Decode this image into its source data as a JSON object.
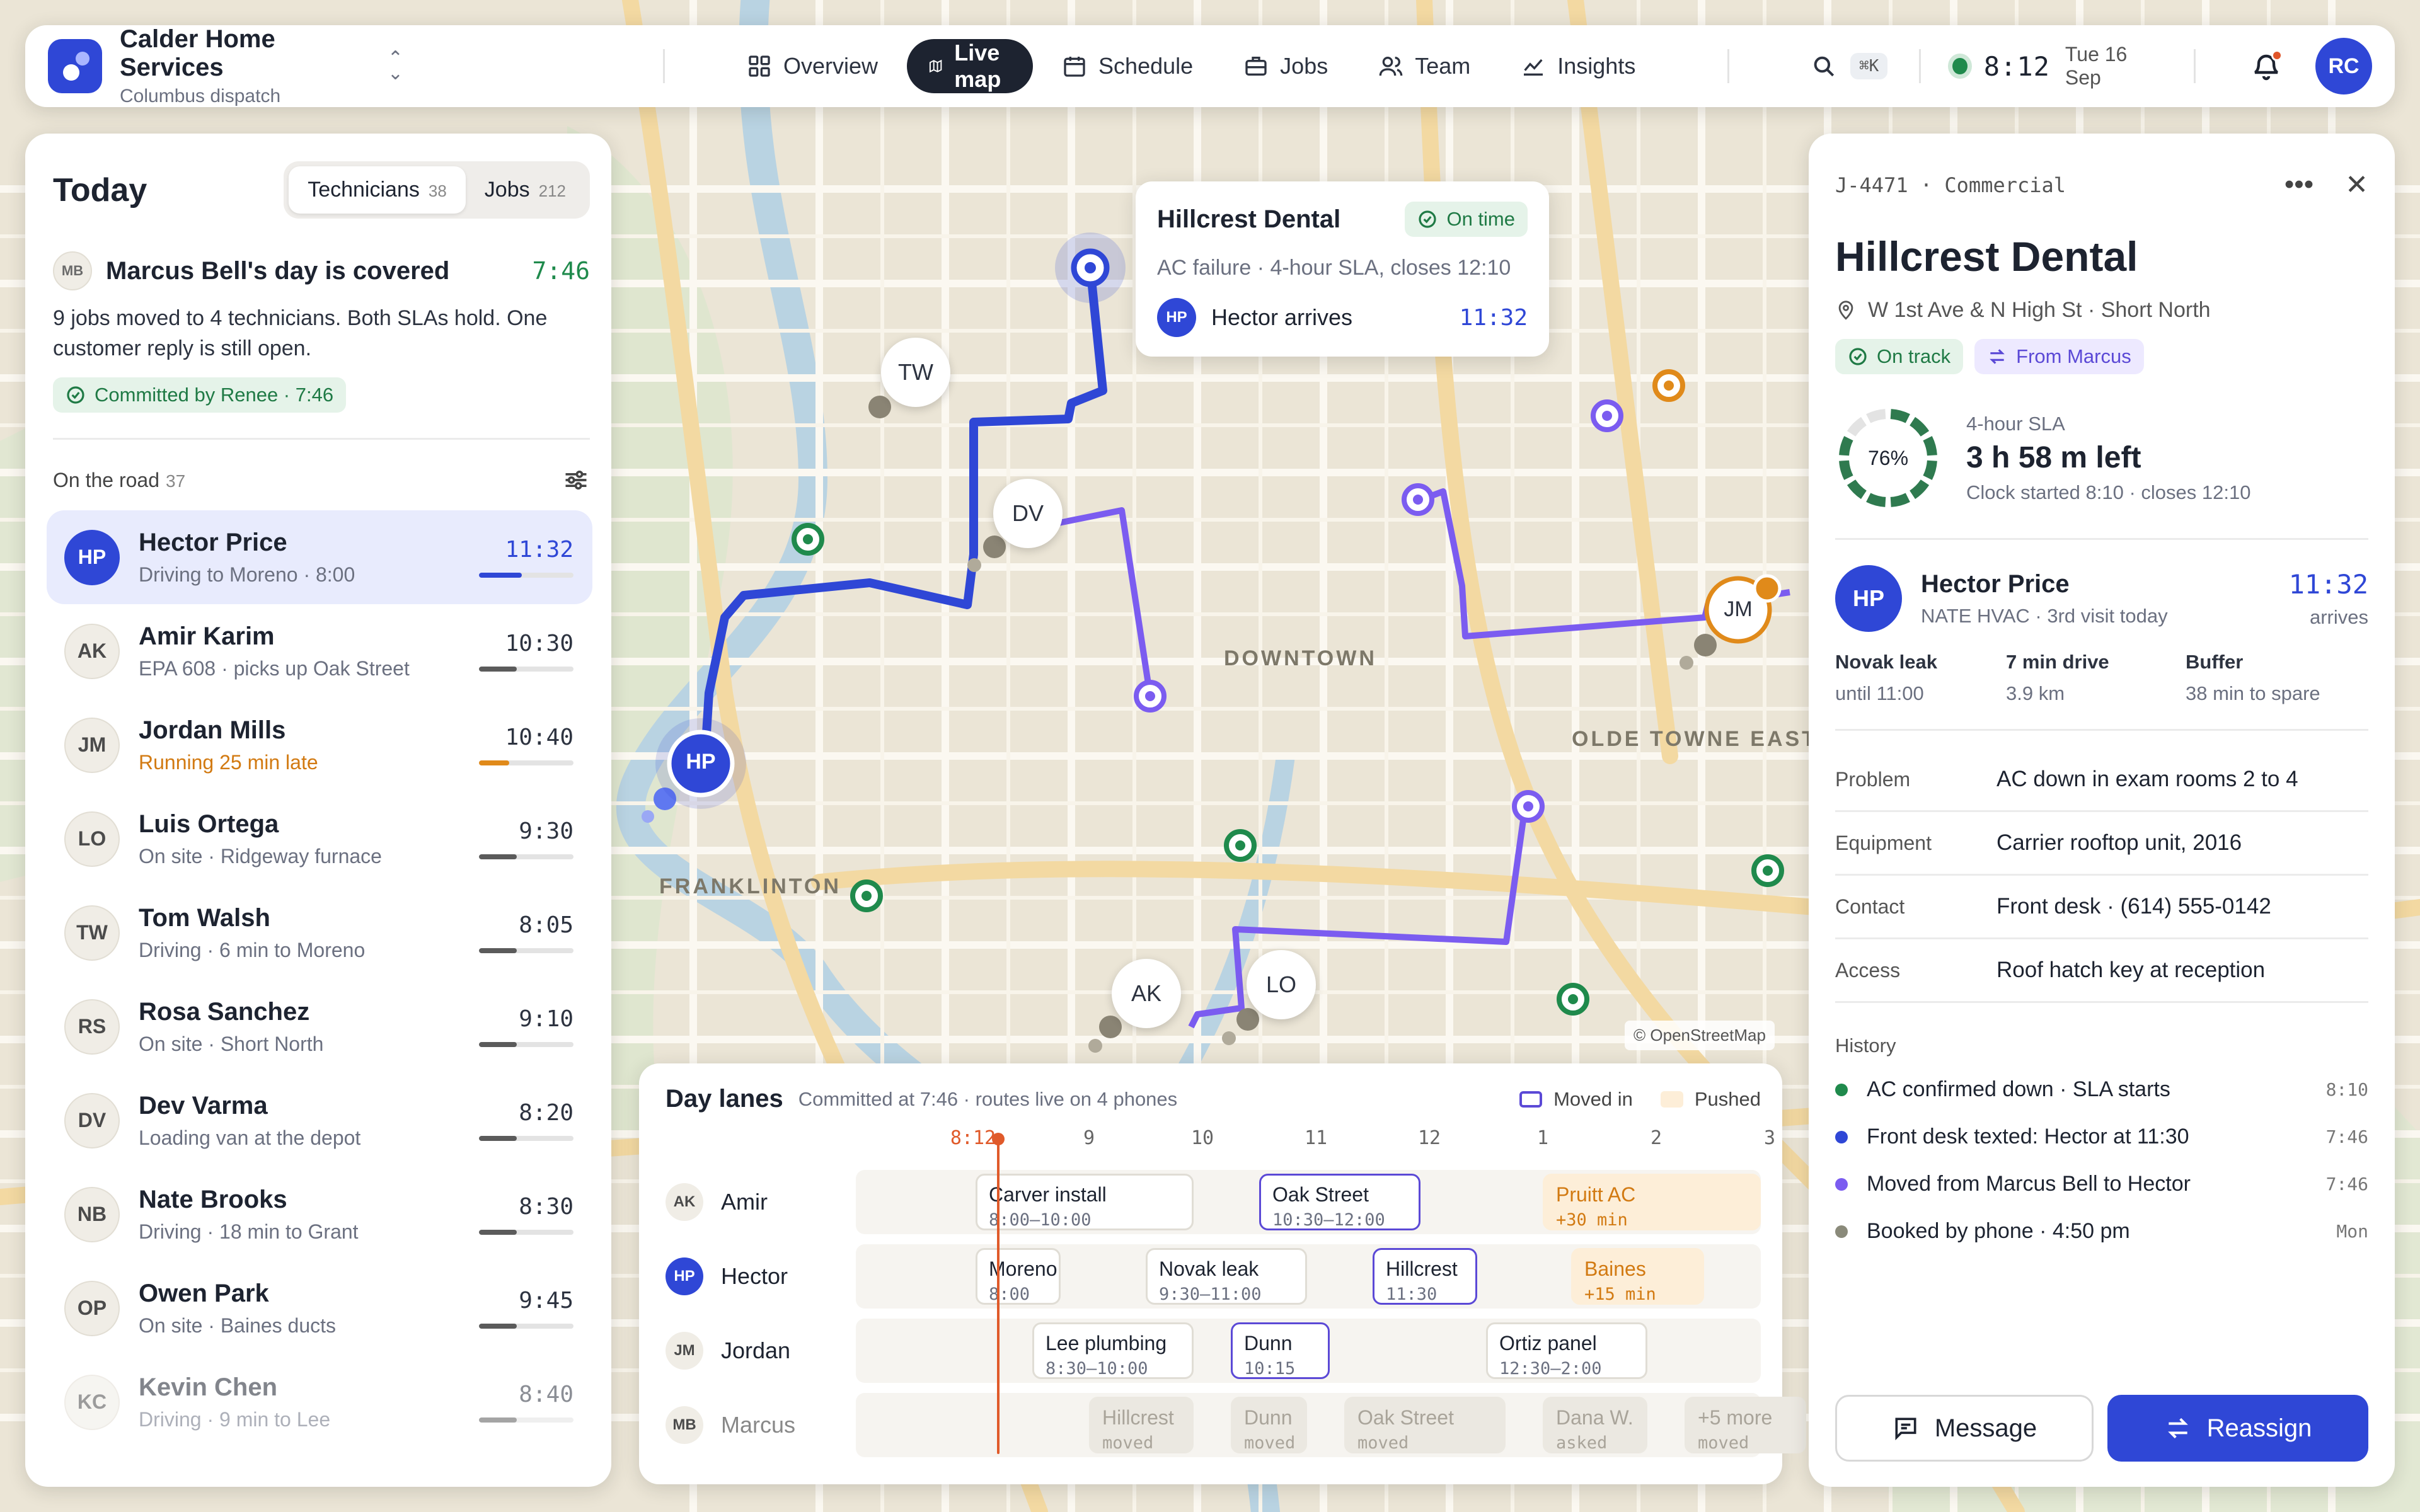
{
  "header": {
    "brand_name": "Calder Home Services",
    "brand_sub": "Columbus dispatch",
    "nav": [
      {
        "label": "Overview",
        "icon": "grid-icon"
      },
      {
        "label": "Live map",
        "icon": "map-icon",
        "active": true
      },
      {
        "label": "Schedule",
        "icon": "calendar-icon"
      },
      {
        "label": "Jobs",
        "icon": "briefcase-icon"
      },
      {
        "label": "Team",
        "icon": "team-icon"
      },
      {
        "label": "Insights",
        "icon": "chart-icon"
      }
    ],
    "shortcut": "⌘K",
    "time": "8:12",
    "date": "Tue 16 Sep",
    "user_initials": "RC"
  },
  "left": {
    "title": "Today",
    "tabs": [
      {
        "label": "Technicians",
        "count": "38"
      },
      {
        "label": "Jobs",
        "count": "212"
      }
    ],
    "cover": {
      "initials": "MB",
      "title": "Marcus Bell's day is covered",
      "time": "7:46",
      "body": "9 jobs moved to 4 technicians. Both SLAs hold. One customer reply is still open.",
      "committed": "Committed by Renee · 7:46"
    },
    "road_label": "On the road",
    "road_count": "37",
    "techs": [
      {
        "initials": "HP",
        "name": "Hector Price",
        "sub": "Driving to Moreno · 8:00",
        "time": "11:32",
        "progress": 0.45,
        "selected": true
      },
      {
        "initials": "AK",
        "name": "Amir Karim",
        "sub": "EPA 608 · picks up Oak Street",
        "time": "10:30",
        "progress": 0.4
      },
      {
        "initials": "JM",
        "name": "Jordan Mills",
        "sub": "Running 25 min late",
        "time": "10:40",
        "progress": 0.32,
        "late": true
      },
      {
        "initials": "LO",
        "name": "Luis Ortega",
        "sub": "On site · Ridgeway furnace",
        "time": "9:30",
        "progress": 0.4
      },
      {
        "initials": "TW",
        "name": "Tom Walsh",
        "sub": "Driving · 6 min to Moreno",
        "time": "8:05",
        "progress": 0.4
      },
      {
        "initials": "RS",
        "name": "Rosa Sanchez",
        "sub": "On site · Short North",
        "time": "9:10",
        "progress": 0.4
      },
      {
        "initials": "DV",
        "name": "Dev Varma",
        "sub": "Loading van at the depot",
        "time": "8:20",
        "progress": 0.4
      },
      {
        "initials": "NB",
        "name": "Nate Brooks",
        "sub": "Driving · 18 min to Grant",
        "time": "8:30",
        "progress": 0.4
      },
      {
        "initials": "OP",
        "name": "Owen Park",
        "sub": "On site · Baines ducts",
        "time": "9:45",
        "progress": 0.4
      },
      {
        "initials": "KC",
        "name": "Kevin Chen",
        "sub": "Driving · 9 min to Lee",
        "time": "8:40",
        "progress": 0.4,
        "dim": true
      }
    ]
  },
  "map": {
    "chips": [
      "TW",
      "DV",
      "AK",
      "LO",
      "HP",
      "JM"
    ],
    "districts": [
      "DOWNTOWN",
      "OLDE TOWNE EAST",
      "FRANKLINTON"
    ],
    "attribution": "© OpenStreetMap",
    "popup": {
      "title": "Hillcrest Dental",
      "status": "On time",
      "sub": "AC failure · 4-hour SLA, closes 12:10",
      "initials": "HP",
      "arrives": "Hector arrives",
      "time": "11:32"
    }
  },
  "lanes": {
    "title": "Day lanes",
    "sub": "Committed at 7:46 · routes live on 4 phones",
    "legend": [
      "Moved in",
      "Pushed"
    ],
    "now_label": "8:12",
    "ticks": [
      "9",
      "10",
      "11",
      "12",
      "1",
      "2",
      "3"
    ],
    "rows": [
      {
        "initials": "AK",
        "name": "Amir",
        "blocks": [
          {
            "title": "Carver install",
            "sub": "8:00–10:00"
          },
          {
            "title": "Oak Street",
            "sub": "10:30–12:00"
          },
          {
            "title": "Pruitt AC",
            "sub": "+30 min"
          }
        ]
      },
      {
        "initials": "HP",
        "name": "Hector",
        "blocks": [
          {
            "title": "Moreno",
            "sub": "8:00"
          },
          {
            "title": "Novak leak",
            "sub": "9:30–11:00"
          },
          {
            "title": "Hillcrest",
            "sub": "11:30"
          },
          {
            "title": "Baines",
            "sub": "+15 min"
          }
        ]
      },
      {
        "initials": "JM",
        "name": "Jordan",
        "blocks": [
          {
            "title": "Lee plumbing",
            "sub": "8:30–10:00"
          },
          {
            "title": "Dunn",
            "sub": "10:15"
          },
          {
            "title": "Ortiz panel",
            "sub": "12:30–2:00"
          }
        ]
      },
      {
        "initials": "MB",
        "name": "Marcus",
        "blocks": [
          {
            "title": "Hillcrest",
            "sub": "moved"
          },
          {
            "title": "Dunn",
            "sub": "moved"
          },
          {
            "title": "Oak Street",
            "sub": "moved"
          },
          {
            "title": "Dana W.",
            "sub": "asked"
          },
          {
            "title": "+5 more",
            "sub": "moved"
          }
        ]
      }
    ]
  },
  "detail": {
    "job_id": "J-4471 · Commercial",
    "title": "Hillcrest Dental",
    "address": "W 1st Ave & N High St · Short North",
    "status": "On track",
    "from": "From Marcus",
    "sla_percent": 76,
    "sla_percent_label": "76%",
    "sla_label": "4-hour SLA",
    "sla_left": "3 h 58 m left",
    "sla_sub": "Clock started 8:10 · closes 12:10",
    "assignee": {
      "initials": "HP",
      "name": "Hector Price",
      "sub": "NATE HVAC · 3rd visit today",
      "time": "11:32",
      "time_label": "arrives"
    },
    "stats": [
      {
        "k": "Novak leak",
        "v": "until 11:00"
      },
      {
        "k": "7 min drive",
        "v": "3.9 km"
      },
      {
        "k": "Buffer",
        "v": "38 min to spare"
      }
    ],
    "fields": [
      {
        "k": "Problem",
        "v": "AC down in exam rooms 2 to 4"
      },
      {
        "k": "Equipment",
        "v": "Carrier rooftop unit, 2016"
      },
      {
        "k": "Contact",
        "v": "Front desk · (614) 555-0142"
      },
      {
        "k": "Access",
        "v": "Roof hatch key at reception"
      }
    ],
    "history_label": "History",
    "history": [
      {
        "text": "AC confirmed down · SLA starts",
        "time": "8:10",
        "color": "#1f8a4c"
      },
      {
        "text": "Front desk texted: Hector at 11:30",
        "time": "7:46",
        "color": "#2f47d6"
      },
      {
        "text": "Moved from Marcus Bell to Hector",
        "time": "7:46",
        "color": "#7b5cf0"
      },
      {
        "text": "Booked by phone · 4:50 pm",
        "time": "Mon",
        "color": "#8a8a7a"
      }
    ],
    "message_label": "Message",
    "reassign_label": "Reassign"
  },
  "colors": {
    "accent": "#2f47d6",
    "purple_route": "#7b5cf0",
    "green": "#1f8a4c",
    "orange": "#e08a1a",
    "now_line": "#e05a2a"
  }
}
